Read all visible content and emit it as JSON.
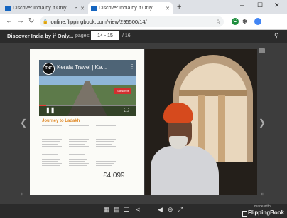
{
  "browser": {
    "tabs": [
      {
        "title": "Discover India by if Only... | Publi",
        "active": false
      },
      {
        "title": "Discover India by if Only...",
        "active": true
      }
    ],
    "new_tab": "+",
    "window_controls": [
      "–",
      "☐",
      "✕"
    ],
    "address": "online.flippingbook.com/view/295500/14/",
    "extension_letter": "C"
  },
  "viewer": {
    "doc_title": "Discover India by if Only...",
    "pages_label": "pages:",
    "pages_value": "14 - 15",
    "pages_total": "/ 16"
  },
  "spread": {
    "video_title": "Kerala Travel | Ke...",
    "channel": "TNF",
    "subscribe": "Subscribe",
    "video_progress": 0.07,
    "article_heading": "Journey to Ladakh",
    "price": "£4,099"
  },
  "footer": {
    "made_with": "made with",
    "brand": "FlippingBook"
  },
  "colors": {
    "accent_orange": "#e08a2a",
    "viewer_bg": "#3d3d3d",
    "bar_bg": "#2b2b2b"
  }
}
